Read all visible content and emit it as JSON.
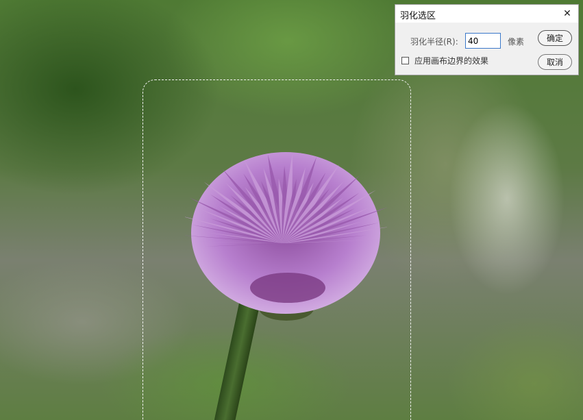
{
  "dialog": {
    "title": "羽化选区",
    "close_icon": "close-icon",
    "radius_label": "羽化半径(R):",
    "radius_value": "40",
    "unit_label": "像素",
    "checkbox_label": "应用画布边界的效果",
    "checkbox_checked": false,
    "ok_label": "确定",
    "cancel_label": "取消",
    "accent_color": "#3a78c9"
  },
  "canvas": {
    "subject": "flower-photo"
  }
}
